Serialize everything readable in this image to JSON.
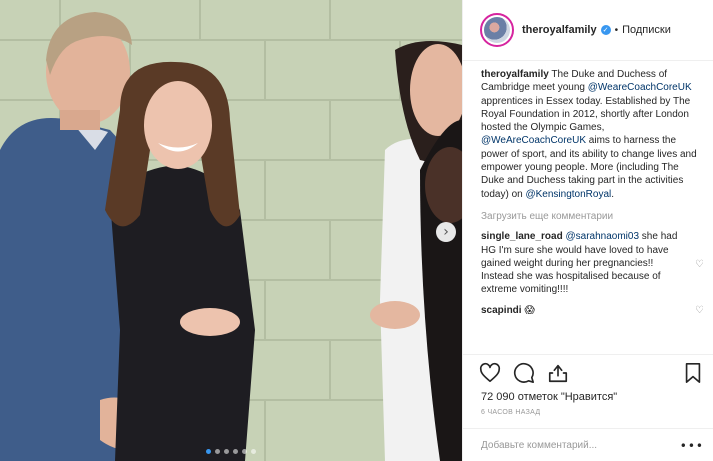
{
  "post": {
    "image_alt": "",
    "carousel": {
      "dot_count": 6,
      "active_index": 0
    },
    "next_arrow": "›"
  },
  "header": {
    "username": "theroyalfamily",
    "separator": "•",
    "follow_label": "Подписки"
  },
  "caption": {
    "username": "theroyalfamily",
    "text_1": " The Duke and Duchess of Cambridge meet young ",
    "mention_1": "@WeareCoachCoreUK",
    "text_2": " apprentices in Essex today. Established by The Royal Foundation in 2012, shortly after London hosted the Olympic Games, ",
    "mention_2": "@WeAreCoachCoreUK",
    "text_3": " aims to harness the power of sport, and its ability to change lives and empower young people. More (including The Duke and Duchess taking part in the activities today) on ",
    "mention_3": "@KensingtonRoyal",
    "text_4": "."
  },
  "load_more_label": "Загрузить еще комментарии",
  "comments": [
    {
      "username": "single_lane_road",
      "mention": "@sarahnaomi03",
      "text": " she had HG I'm sure she would have loved to have gained weight during her pregnancies!! Instead she was hospitalised because of extreme vomiting!!!!"
    },
    {
      "username": "scapindi",
      "text": "😱"
    }
  ],
  "actions": {
    "likes": "72 090 отметок \"Нравится\"",
    "timestamp": "6 ЧАСОВ НАЗАД",
    "comment_placeholder": "Добавьте комментарий...",
    "more_glyph": "•••"
  },
  "colors": {
    "verified": "#3897f0",
    "mention": "#003569",
    "muted": "#999999",
    "active_dot": "#3897f0"
  },
  "icons": [
    "heart-icon",
    "comment-icon",
    "share-icon",
    "bookmark-icon",
    "verified-badge-icon",
    "chevron-right-icon",
    "heart-small-icon"
  ]
}
